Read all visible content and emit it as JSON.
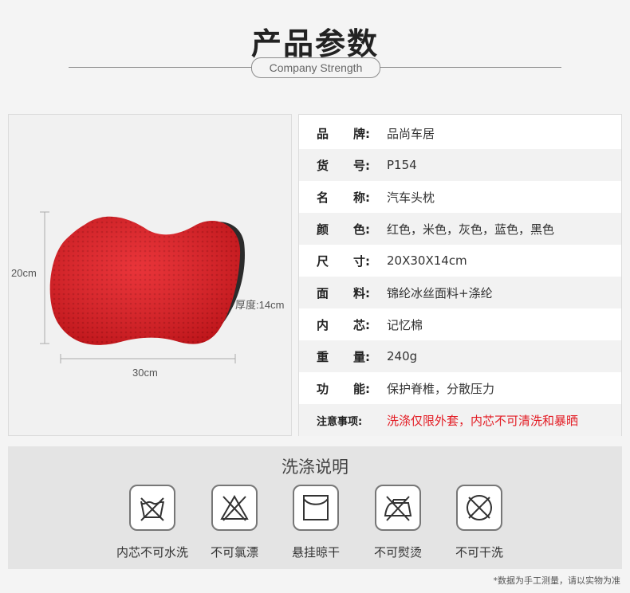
{
  "header": {
    "title": "产品参数",
    "subtitle": "Company Strength"
  },
  "image": {
    "product": "pillow-icon",
    "color": "#e5181e",
    "height_label": "20cm",
    "width_label": "30cm",
    "depth_label": "厚度:14cm"
  },
  "specs": [
    {
      "label_a": "品",
      "label_b": "牌:",
      "value": "品尚车居"
    },
    {
      "label_a": "货",
      "label_b": "号:",
      "value": "P154"
    },
    {
      "label_a": "名",
      "label_b": "称:",
      "value": "汽车头枕"
    },
    {
      "label_a": "颜",
      "label_b": "色:",
      "value": "红色，米色，灰色，蓝色，黑色"
    },
    {
      "label_a": "尺",
      "label_b": "寸:",
      "value": "20X30X14cm"
    },
    {
      "label_a": "面",
      "label_b": "料:",
      "value": "锦纶冰丝面料+涤纶"
    },
    {
      "label_a": "内",
      "label_b": "芯:",
      "value": "记忆棉"
    },
    {
      "label_a": "重",
      "label_b": "量:",
      "value": "240g"
    },
    {
      "label_a": "功",
      "label_b": "能:",
      "value": "保护脊椎，分散压力"
    },
    {
      "label_a": "注意事项:",
      "label_b": "",
      "value": "洗涤仅限外套，内芯不可清洗和暴晒"
    }
  ],
  "wash": {
    "title": "洗涤说明",
    "items": [
      {
        "icon": "no-wash-icon",
        "label": "内芯不可水洗"
      },
      {
        "icon": "no-bleach-icon",
        "label": "不可氯漂"
      },
      {
        "icon": "hang-dry-icon",
        "label": "悬挂晾干"
      },
      {
        "icon": "no-iron-icon",
        "label": "不可熨烫"
      },
      {
        "icon": "no-dry-clean-icon",
        "label": "不可干洗"
      }
    ]
  },
  "note": "*数据为手工测量，请以实物为准",
  "colors": {
    "accent_red": "#e31b23",
    "row_alt": "#f2f2f2"
  }
}
